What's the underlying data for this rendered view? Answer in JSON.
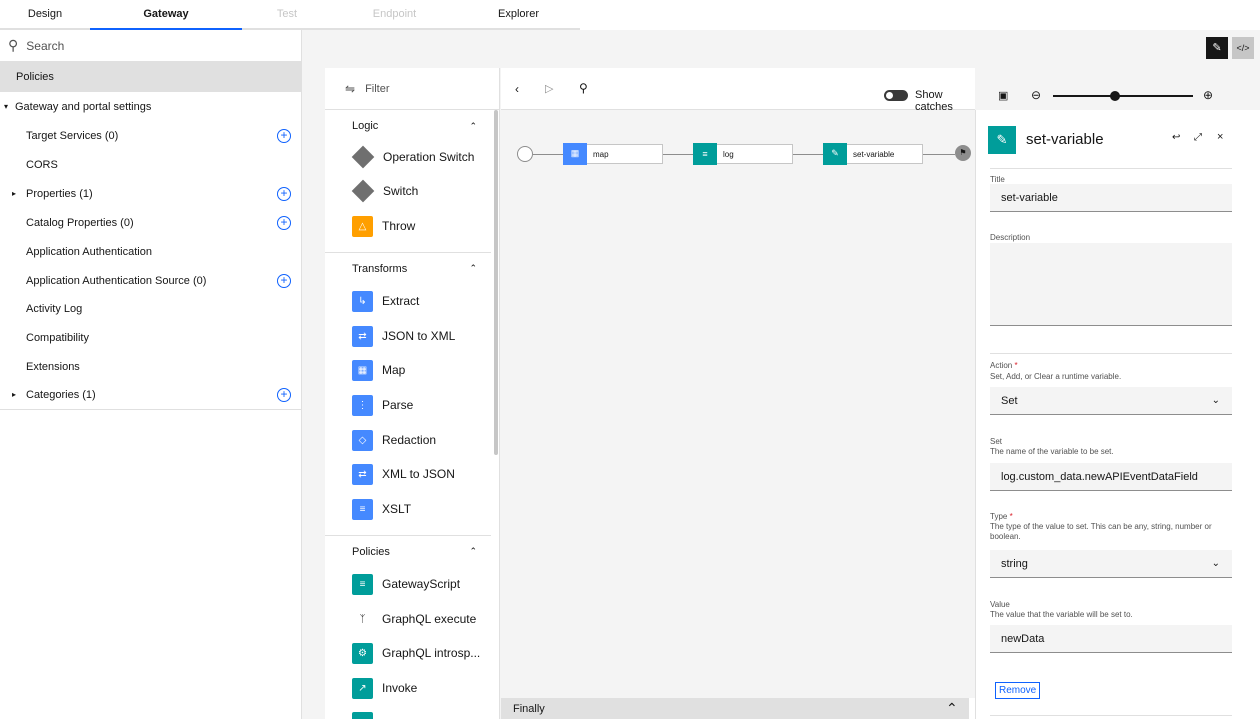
{
  "tabs": [
    {
      "label": "Design"
    },
    {
      "label": "Gateway"
    },
    {
      "label": "Test"
    },
    {
      "label": "Endpoint"
    },
    {
      "label": "Explorer"
    }
  ],
  "sidebar": {
    "search_placeholder": "Search",
    "policies": "Policies",
    "group": "Gateway and portal settings",
    "items": [
      {
        "label": "Target Services (0)"
      },
      {
        "label": "CORS"
      },
      {
        "label": "Properties (1)"
      },
      {
        "label": "Catalog Properties (0)"
      },
      {
        "label": "Application Authentication"
      },
      {
        "label": "Application Authentication Source (0)"
      },
      {
        "label": "Activity Log"
      },
      {
        "label": "Compatibility"
      },
      {
        "label": "Extensions"
      },
      {
        "label": "Categories (1)"
      }
    ]
  },
  "palette": {
    "filter": "Filter",
    "logic": {
      "title": "Logic",
      "items": [
        "Operation Switch",
        "Switch",
        "Throw"
      ]
    },
    "transforms": {
      "title": "Transforms",
      "items": [
        "Extract",
        "JSON to XML",
        "Map",
        "Parse",
        "Redaction",
        "XML to JSON",
        "XSLT"
      ]
    },
    "policies": {
      "title": "Policies",
      "items": [
        "GatewayScript",
        "GraphQL execute",
        "GraphQL introsp...",
        "Invoke"
      ]
    }
  },
  "canvas": {
    "show_catches": "Show catches",
    "nodes": [
      "map",
      "log",
      "set-variable"
    ],
    "finally": "Finally"
  },
  "panel": {
    "title": "set-variable",
    "title_label": "Title",
    "title_value": "set-variable",
    "description_label": "Description",
    "action_label": "Action",
    "action_help": "Set, Add, or Clear a runtime variable.",
    "action_value": "Set",
    "set_label": "Set",
    "set_help": "The name of the variable to be set.",
    "set_value": "log.custom_data.newAPIEventDataField",
    "type_label": "Type",
    "type_help": "The type of the value to set. This can be any, string, number or boolean.",
    "type_value": "string",
    "value_label": "Value",
    "value_help": "The value that the variable will be set to.",
    "value_value": "newData",
    "remove": "Remove",
    "required": "*"
  },
  "colors": {
    "accent": "#0f62fe",
    "teal": "#009d9a",
    "blue": "#4589ff",
    "orange": "#ff9f00"
  }
}
